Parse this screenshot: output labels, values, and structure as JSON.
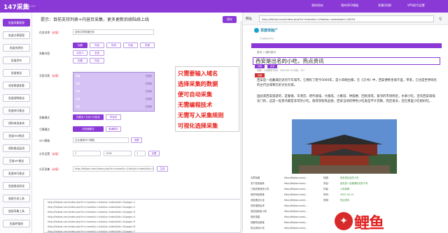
{
  "app": {
    "title": "147采集",
    "version": "V1.0.0"
  },
  "topnav": [
    "我的网站",
    "我的SEO模板",
    "采集QQ群",
    "VPS保号设置"
  ],
  "sidebar": [
    "批量采集管理",
    "批量文章管理",
    "批量伪原创",
    "批量发布",
    "批量推送",
    "收录数据查看",
    "批量搜狗推送",
    "批量神马推送",
    "搜狗收录查询",
    "批量360推送",
    "搜狗推送监测",
    "百度API推送",
    "批量神马推送",
    "批量推送收录",
    "链接生成工具",
    "链接采集工具",
    "批量转链接"
  ],
  "hint": "提示：目前支持列表+内容页采集，更多更新后续陆续上线",
  "save_label": "保存",
  "form": {
    "task_name_label": "任务名称",
    "required": "（必填）",
    "task_name_value": "全网文章采集任务",
    "collect_content_label": "采集内容",
    "content_buttons": [
      "标题",
      "内容",
      "时间",
      "作者",
      "来源"
    ],
    "extra_buttons": [
      "自定义",
      "全选"
    ],
    "field_label": "字段列表",
    "fields": [
      {
        "name": "标题",
        "value": "已配置"
      },
      {
        "name": "内容",
        "value": "已配置"
      },
      {
        "name": "时间",
        "value": "已配置"
      },
      {
        "name": "作者",
        "value": "已配置"
      },
      {
        "name": "来源",
        "value": "已配置"
      }
    ],
    "mode_label": "采集模式",
    "mode_options": [
      "列表页+分页+内容页",
      "内容页"
    ],
    "engine_label": "引擎模式",
    "engine_options": [
      "浏览器模式",
      "普通模式"
    ],
    "seo_label": "SEO模板",
    "seo_value": "企业通用SEO模板",
    "seo_button": "设置",
    "page_label": "分页设置",
    "page_from": "1",
    "page_to": "1000",
    "page_step": "1",
    "page_btn": "设置",
    "list_label": "分页采集",
    "list_value": "http://feijiasi.com/index.php?m=home&c=Lists&a=index&tid=1&page={n}",
    "list_btn": "生成",
    "urls": [
      "http://feijiasi.com/index.php?m=home&c=Lists&a=index&tid=1&page=1",
      "http://feijiasi.com/index.php?m=home&c=Lists&a=index&tid=1&page=2",
      "http://feijiasi.com/index.php?m=home&c=Lists&a=index&tid=1&page=3",
      "http://feijiasi.com/index.php?m=home&c=Lists&a=index&tid=1&page=4",
      "http://feijiasi.com/index.php?m=home&c=Lists&a=index&tid=1&page=5",
      "http://feijiasi.com/index.php?m=home&c=Lists&a=index&tid=1&page=6",
      "http://feijiasi.com/index.php?m=home&c=Lists&a=index&tid=1&page=7",
      "http://feijiasi.com/index.php?m=home&c=Lists&a=index&tid=1&page=8",
      "http://feijiasi.com/index.php?m=home&c=Lists&a=index&tid=1&page=9",
      "http://feijiasi.com/index.php?m=home&c=Lists&a=index&tid=1&page=10"
    ]
  },
  "preview": {
    "title_label": "网址",
    "url": "http://feijiasi.com/index.php?m=home&c=View&a=index&aid=16239",
    "logo": "百度体验广",
    "logo_sub": "专注体验分享平台",
    "breadcrumb": "首页 > 国内资讯",
    "article_title": "西安是出名的小吃，热点资讯",
    "tag_a": "内容",
    "tag_b": "来源",
    "meta": "来源：小米新闻   时间：2022-05-14   浏览：227",
    "tag_c": "内容",
    "paragraphs": [
      "西安是一处戴满历史的千年城市，它拥有了距今5000年，是十四朝古都，在《汉书》中，西安便称金城千里，草莱，它也是世界闻名的古代古城和历史文化名城。",
      "固此来西安旅游的，是秦俑、华清宫、明代城墙、大雁塔、小雁塔、钟鼓楼、回民街等，紧邻的市场附近，水果小吃，还有西安城墙北门的，这是一处景点都是非常的小吃，值得游客来品尝，西安当地的特色小吃类型不计其数，而且很多，还在那里小吃很好吃。"
    ],
    "table": [
      {
        "c1": "文章标题",
        "c2": "http://feijiasi.com/...",
        "c3": "标题：",
        "c4": "西安是出名的小吃"
      },
      {
        "c1": "关于西安面条",
        "c2": "http://feijiasi.com/...",
        "c3": "内容：",
        "c4": "西安是一处戴满历史的千年"
      },
      {
        "c1": "三碗农家西安小吃",
        "c2": "http://feijiasi.com/...",
        "c3": "作者：",
        "c4": "小米新闻"
      },
      {
        "c1": "西安特色美食",
        "c2": "http://feijiasi.com/...",
        "c3": "时间：",
        "c4": "2022-05-14"
      },
      {
        "c1": "凉皮做法大全",
        "c2": "http://feijiasi.com/...",
        "c3": "来源：",
        "c4": "热点资讯"
      },
      {
        "c1": "肉夹馍的由来",
        "c2": "http://feijiasi.com/...",
        "c3": "",
        "c4": ""
      },
      {
        "c1": "西安回民街小吃",
        "c2": "http://feijiasi.com/...",
        "c3": "",
        "c4": ""
      },
      {
        "c1": "西安泡馍",
        "c2": "http://feijiasi.com/...",
        "c3": "",
        "c4": ""
      },
      {
        "c1": "钟楼附近美食",
        "c2": "http://feijiasi.com/...",
        "c3": "",
        "c4": ""
      },
      {
        "c1": "热点资讯小吃",
        "c2": "http://feijiasi.com/...",
        "c3": "",
        "c4": ""
      }
    ]
  },
  "callout": [
    "只需要输入域名",
    "选择采集的数据",
    "便可自动采集",
    "无需编程技术",
    "无需写入采集规则",
    "可视化选择采集"
  ],
  "watermark": "鲤鱼"
}
